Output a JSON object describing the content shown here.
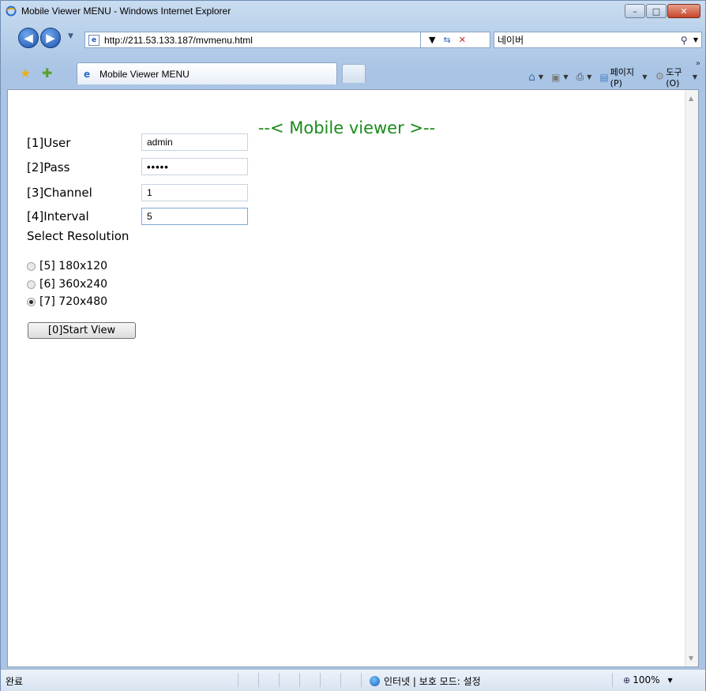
{
  "window": {
    "title": "Mobile Viewer MENU - Windows Internet Explorer",
    "controls": {
      "minimize": "–",
      "maximize": "□",
      "close": "✕"
    }
  },
  "navigation": {
    "back_glyph": "◀",
    "forward_glyph": "▶",
    "url": "http://211.53.133.187/mvmenu.html",
    "search_value": "네이버"
  },
  "tabs": [
    {
      "label": "Mobile Viewer MENU"
    }
  ],
  "command_bar": {
    "page_label": "페이지(P)",
    "tools_label": "도구(O)"
  },
  "page": {
    "heading": "--< Mobile viewer >--",
    "fields": [
      {
        "label": "[1]User",
        "value": "admin"
      },
      {
        "label": "[2]Pass",
        "value": "•••••"
      },
      {
        "label": "[3]Channel",
        "value": "1"
      },
      {
        "label": "[4]Interval",
        "value": "5"
      }
    ],
    "resolution_title": "Select Resolution",
    "resolutions": [
      {
        "label": "[5] 180x120",
        "checked": false
      },
      {
        "label": "[6] 360x240",
        "checked": false
      },
      {
        "label": "[7] 720x480",
        "checked": true
      }
    ],
    "start_button": "[0]Start View"
  },
  "status_bar": {
    "status": "완료",
    "zone": "인터넷 | 보호 모드: 설정",
    "zoom": "100%"
  },
  "colors": {
    "heading": "#1b8b1b",
    "chrome": "#c9dcf0"
  },
  "icons": [
    "ie-icon",
    "back-icon",
    "forward-icon",
    "page-icon",
    "refresh-icon",
    "stop-icon",
    "search-icon",
    "favorites-star-icon",
    "add-favorites-icon",
    "home-icon",
    "feed-icon",
    "print-icon",
    "page-menu-icon",
    "tools-icon",
    "globe-icon",
    "zoom-icon"
  ]
}
